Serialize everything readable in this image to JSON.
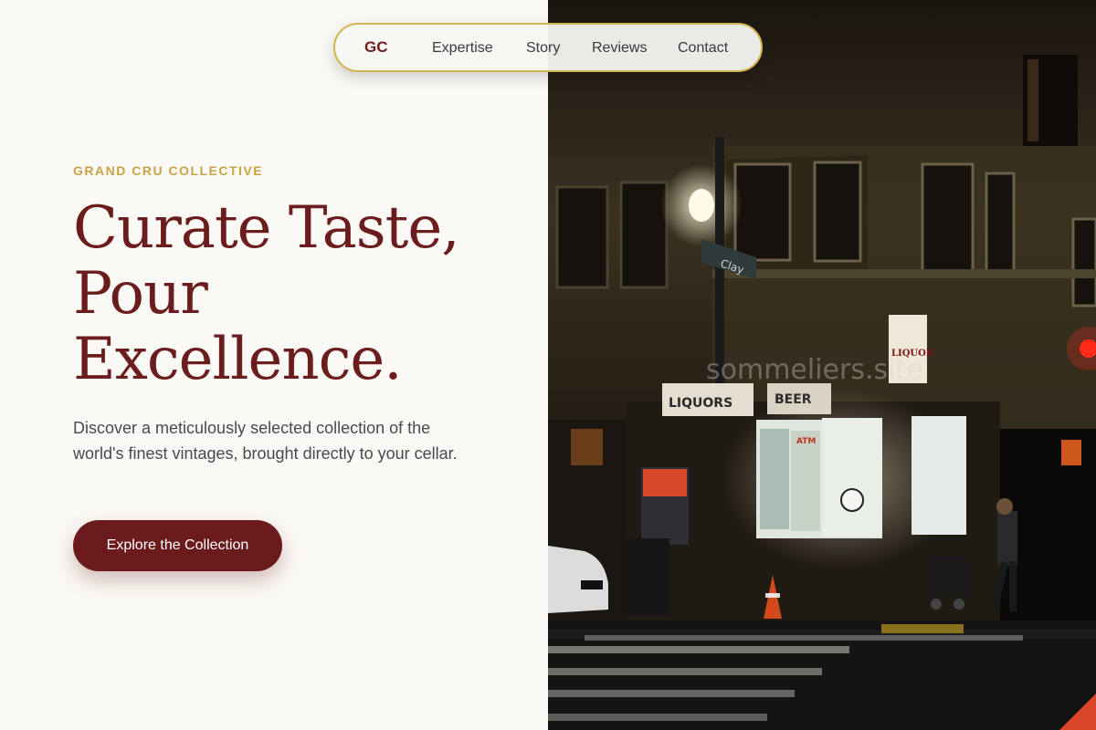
{
  "nav": {
    "logo": "GC",
    "links": [
      "Expertise",
      "Story",
      "Reviews",
      "Contact"
    ]
  },
  "hero": {
    "eyebrow": "GRAND CRU COLLECTIVE",
    "headline_lines": [
      "Curate Taste,",
      "Pour",
      "Excellence."
    ],
    "description": "Discover a meticulously selected collection of the world's finest vintages, brought directly to your cellar.",
    "cta_label": "Explore the Collection"
  },
  "photo": {
    "watermark": "sommeliers.site",
    "street_sign": "Clay",
    "store_sign": "LIQUOR",
    "awning_left": "LIQUORS",
    "awning_right": "BEER",
    "atm_sign": "ATM"
  },
  "colors": {
    "brand": "#6c1b1d",
    "accent_gold": "#d3b356",
    "background": "#fbf9f5"
  }
}
